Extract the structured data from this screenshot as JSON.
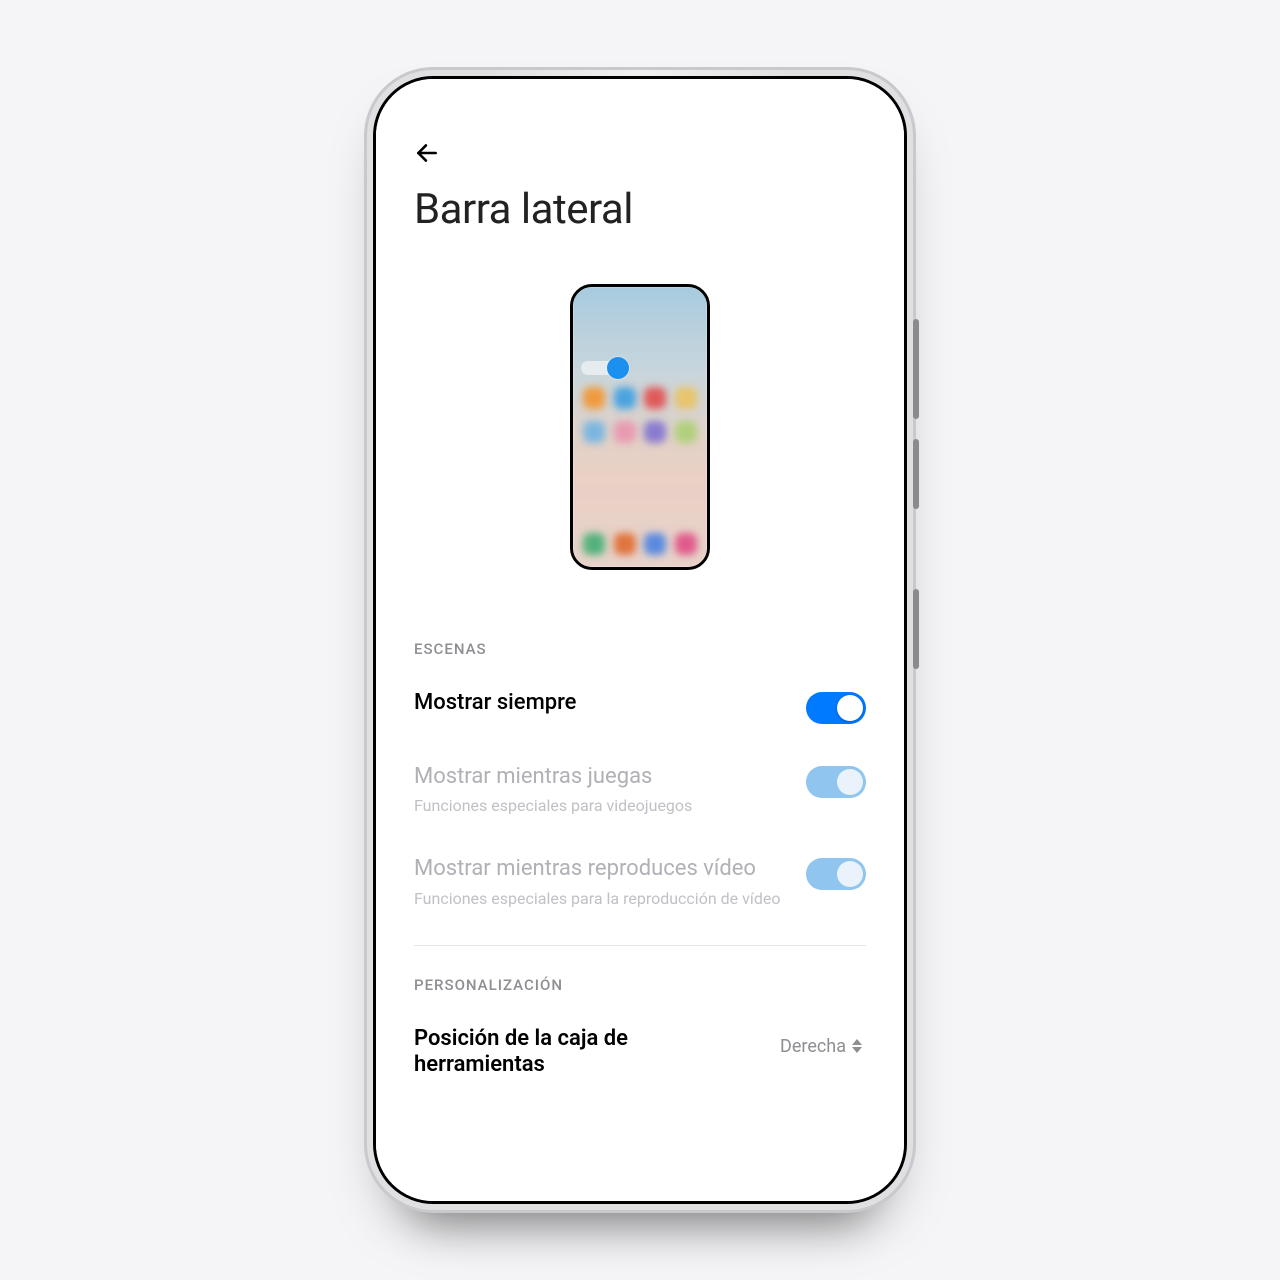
{
  "page_title": "Barra lateral",
  "sections": {
    "scenes": {
      "label": "ESCENAS",
      "items": [
        {
          "title": "Mostrar siempre",
          "subtitle": "",
          "on": true,
          "enabled": true
        },
        {
          "title": "Mostrar mientras juegas",
          "subtitle": "Funciones especiales para videojuegos",
          "on": true,
          "enabled": false
        },
        {
          "title": "Mostrar mientras reproduces vídeo",
          "subtitle": "Funciones especiales para la reproducción de vídeo",
          "on": true,
          "enabled": false
        }
      ]
    },
    "personalization": {
      "label": "PERSONALIZACIÓN",
      "items": [
        {
          "title": "Posición de la caja de herramientas",
          "value": "Derecha"
        }
      ]
    }
  },
  "colors": {
    "accent": "#007aff",
    "accent_disabled": "#8fc5ef",
    "text_secondary": "#8e8e93"
  }
}
